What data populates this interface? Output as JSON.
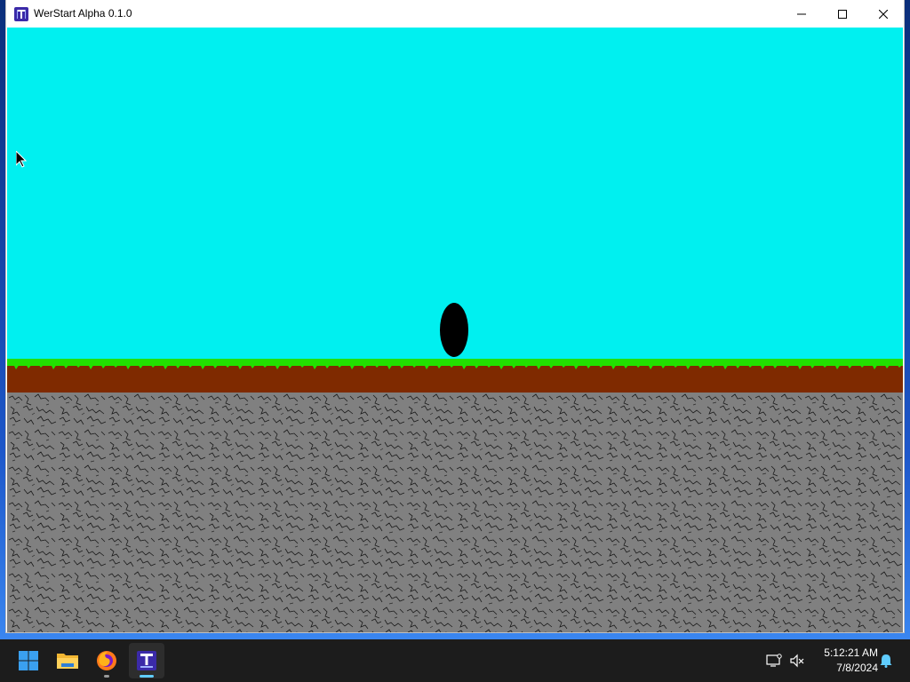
{
  "window": {
    "title": "WerStart Alpha 0.1.0",
    "minimize_icon": "minimize-icon",
    "maximize_icon": "maximize-icon",
    "close_icon": "close-icon"
  },
  "game": {
    "sky_color": "#00f0f0",
    "grass_color": "#22e000",
    "dirt_color": "#7f2a00",
    "stone_color": "#808080",
    "player_color": "#000000"
  },
  "taskbar": {
    "items": [
      {
        "name": "start-button",
        "icon": "windows-logo-icon"
      },
      {
        "name": "file-explorer",
        "icon": "folder-icon"
      },
      {
        "name": "firefox",
        "icon": "firefox-icon"
      },
      {
        "name": "werstart-app",
        "icon": "werstart-app-icon",
        "active": true
      }
    ],
    "tray": {
      "network_icon": "network-disconnected-icon",
      "volume_icon": "volume-muted-icon",
      "notification_icon": "notification-bell-icon"
    },
    "clock": {
      "time": "5:12:21 AM",
      "date": "7/8/2024"
    }
  }
}
